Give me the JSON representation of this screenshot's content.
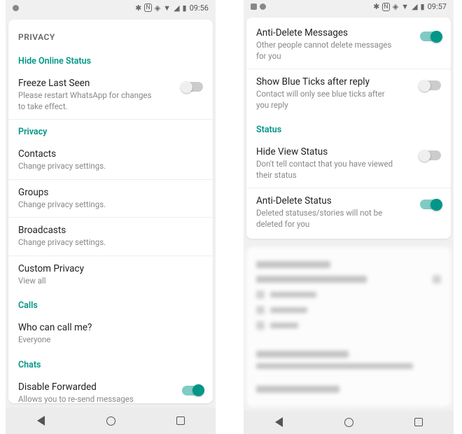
{
  "left": {
    "status_time": "09:56",
    "header": "PRIVACY",
    "sections": {
      "hide_online": {
        "title": "Hide Online Status",
        "freeze_last_seen": {
          "title": "Freeze Last Seen",
          "subtitle": "Please restart WhatsApp for changes to take effect.",
          "on": false
        }
      },
      "privacy": {
        "title": "Privacy",
        "contacts": {
          "title": "Contacts",
          "subtitle": "Change privacy settings."
        },
        "groups": {
          "title": "Groups",
          "subtitle": "Change privacy settings."
        },
        "broadcasts": {
          "title": "Broadcasts",
          "subtitle": "Change privacy settings."
        },
        "custom": {
          "title": "Custom Privacy",
          "subtitle": "View all"
        }
      },
      "calls": {
        "title": "Calls",
        "who_can_call": {
          "title": "Who can call me?",
          "subtitle": "Everyone"
        }
      },
      "chats": {
        "title": "Chats",
        "disable_forwarded": {
          "title": "Disable Forwarded",
          "subtitle": "Allows you to re-send messages without Forwarded tag",
          "on": true
        }
      }
    }
  },
  "right": {
    "status_time": "09:57",
    "sections": {
      "top": {
        "anti_delete_msgs": {
          "title": "Anti-Delete Messages",
          "subtitle": "Other people cannot delete messages for you",
          "on": true
        },
        "blue_ticks": {
          "title": "Show Blue Ticks after reply",
          "subtitle": "Contact will only see blue ticks after you reply",
          "on": false
        }
      },
      "status": {
        "title": "Status",
        "hide_view": {
          "title": "Hide View Status",
          "subtitle": "Don't tell contact that you have viewed their status",
          "on": false
        },
        "anti_delete_status": {
          "title": "Anti-Delete Status",
          "subtitle": "Deleted statuses/stories will not be deleted for you",
          "on": true
        }
      }
    }
  }
}
